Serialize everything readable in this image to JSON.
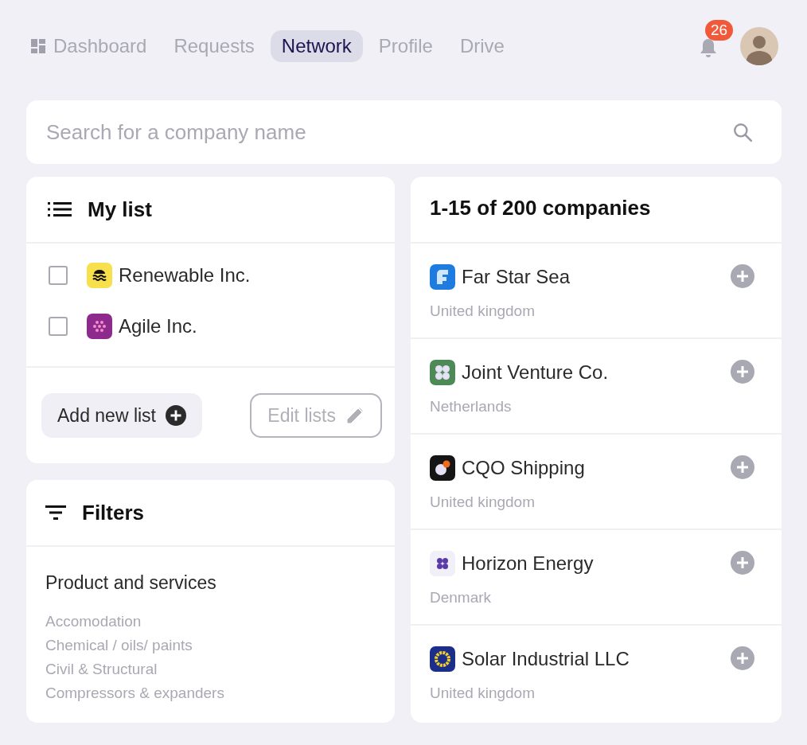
{
  "nav": {
    "tabs": [
      {
        "label": "Dashboard",
        "selected": false,
        "kind": "grid"
      },
      {
        "label": "Requests",
        "selected": false,
        "kind": "text"
      },
      {
        "label": "Network",
        "selected": true,
        "kind": "text"
      },
      {
        "label": "Profile",
        "selected": false,
        "kind": "text"
      },
      {
        "label": "Drive",
        "selected": false,
        "kind": "text"
      }
    ],
    "notification_count": "26"
  },
  "search": {
    "placeholder": "Search for a company name"
  },
  "my_list": {
    "title": "My list",
    "items": [
      {
        "name": "Renewable Inc.",
        "checked": false,
        "kind": "waves",
        "color": "#f7e04b"
      },
      {
        "name": "Agile Inc.",
        "checked": false,
        "kind": "dots",
        "color": "#8e2a8e"
      }
    ],
    "add_button": "Add new list",
    "edit_button": "Edit lists"
  },
  "filters": {
    "title": "Filters",
    "group": "Product and services",
    "options": [
      "Accomodation",
      "Chemical / oils/ paints",
      "Civil & Structural",
      "Compressors & expanders"
    ]
  },
  "results": {
    "title": "1-15 of 200 companies",
    "companies": [
      {
        "name": "Far Star Sea",
        "country": "United kingdom",
        "kind": "flag",
        "color": "#1e7be0"
      },
      {
        "name": "Joint Venture Co.",
        "country": "Netherlands",
        "kind": "clover",
        "color": "#4e8a57"
      },
      {
        "name": "CQO Shipping",
        "country": "United kingdom",
        "kind": "moon",
        "color": "#151515"
      },
      {
        "name": "Horizon Energy",
        "country": "Denmark",
        "kind": "flower",
        "color": "#f1eff8"
      },
      {
        "name": "Solar Industrial LLC",
        "country": "United kingdom",
        "kind": "sun",
        "color": "#1b2f8a"
      }
    ]
  }
}
